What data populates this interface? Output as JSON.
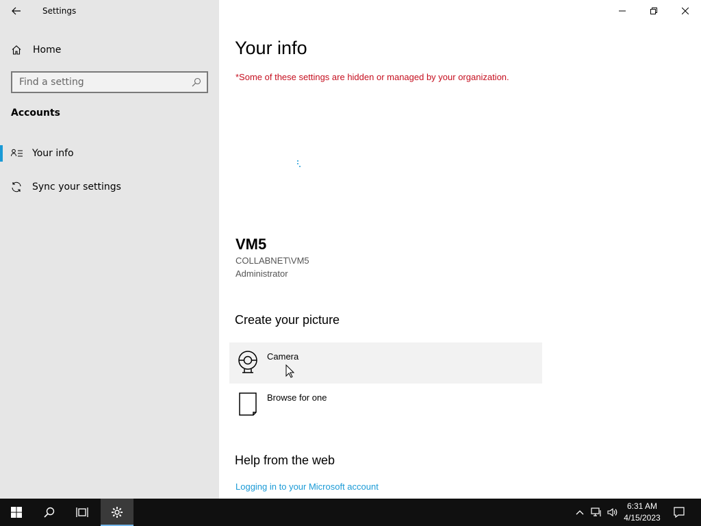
{
  "window": {
    "title": "Settings"
  },
  "sidebar": {
    "home_label": "Home",
    "search_placeholder": "Find a setting",
    "section_title": "Accounts",
    "items": [
      {
        "label": "Your info",
        "icon": "person-list-icon",
        "selected": true
      },
      {
        "label": "Sync your settings",
        "icon": "sync-icon",
        "selected": false
      }
    ]
  },
  "main": {
    "title": "Your info",
    "warning": "*Some of these settings are hidden or managed by your organization.",
    "user": {
      "name": "VM5",
      "domain": "COLLABNET\\VM5",
      "role": "Administrator"
    },
    "picture_section": {
      "title": "Create your picture",
      "options": [
        {
          "label": "Camera",
          "icon": "camera-icon"
        },
        {
          "label": "Browse for one",
          "icon": "file-icon"
        }
      ]
    },
    "help_section": {
      "title": "Help from the web",
      "link": "Logging in to your Microsoft account"
    }
  },
  "taskbar": {
    "time": "6:31 AM",
    "date": "4/15/2023"
  },
  "colors": {
    "accent": "#1a9ad6",
    "warning": "#c50f1f",
    "sidebar_bg": "#e6e6e6",
    "taskbar_bg": "#101010"
  }
}
